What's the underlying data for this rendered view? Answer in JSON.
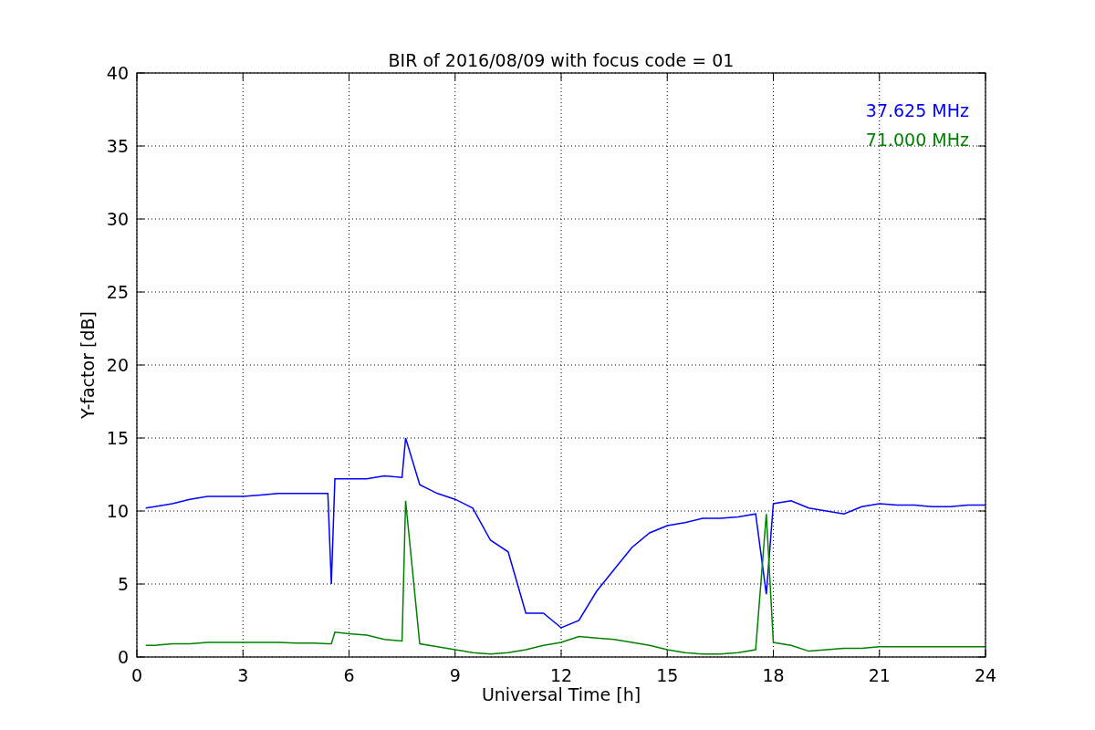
{
  "chart_data": {
    "type": "line",
    "title": "BIR of 2016/08/09 with focus code = 01",
    "xlabel": "Universal Time [h]",
    "ylabel": "Y-factor [dB]",
    "x": [
      0.25,
      0.5,
      1,
      1.5,
      2,
      2.5,
      3,
      3.5,
      4,
      4.5,
      5,
      5.4,
      5.5,
      5.6,
      6,
      6.5,
      7,
      7.5,
      7.6,
      8,
      8.5,
      9,
      9.5,
      10,
      10.5,
      11,
      11.5,
      12,
      12.5,
      13,
      13.5,
      14,
      14.5,
      15,
      15.5,
      16,
      16.5,
      17,
      17.5,
      17.8,
      18,
      18.5,
      19,
      19.5,
      20,
      20.5,
      21,
      21.5,
      22,
      22.5,
      23,
      23.5,
      24
    ],
    "series": [
      {
        "name": "37.625 MHz",
        "color": "#0000ff",
        "values": [
          10.2,
          10.3,
          10.5,
          10.8,
          11.0,
          11.0,
          11.0,
          11.1,
          11.2,
          11.2,
          11.2,
          11.2,
          5.0,
          12.2,
          12.2,
          12.2,
          12.4,
          12.3,
          15.0,
          11.8,
          11.2,
          10.8,
          10.2,
          8.0,
          7.2,
          3.0,
          3.0,
          2.0,
          2.5,
          4.5,
          6.0,
          7.5,
          8.5,
          9.0,
          9.2,
          9.5,
          9.5,
          9.6,
          9.8,
          4.3,
          10.5,
          10.7,
          10.2,
          10.0,
          9.8,
          10.3,
          10.5,
          10.4,
          10.4,
          10.3,
          10.3,
          10.4,
          10.4
        ]
      },
      {
        "name": "71.000 MHz",
        "color": "#008000",
        "values": [
          0.8,
          0.8,
          0.9,
          0.9,
          1.0,
          1.0,
          1.0,
          1.0,
          1.0,
          0.95,
          0.95,
          0.9,
          0.9,
          1.7,
          1.6,
          1.5,
          1.2,
          1.1,
          10.7,
          0.9,
          0.7,
          0.5,
          0.3,
          0.2,
          0.3,
          0.5,
          0.8,
          1.0,
          1.4,
          1.3,
          1.2,
          1.0,
          0.8,
          0.5,
          0.3,
          0.2,
          0.2,
          0.3,
          0.5,
          9.8,
          1.0,
          0.8,
          0.4,
          0.5,
          0.6,
          0.6,
          0.7,
          0.7,
          0.7,
          0.7,
          0.7,
          0.7,
          0.7
        ]
      }
    ],
    "xlim": [
      0,
      24
    ],
    "ylim": [
      0,
      40
    ],
    "xticks": [
      0,
      3,
      6,
      9,
      12,
      15,
      18,
      21,
      24
    ],
    "yticks": [
      0,
      5,
      10,
      15,
      20,
      25,
      30,
      35,
      40
    ],
    "grid": true
  }
}
